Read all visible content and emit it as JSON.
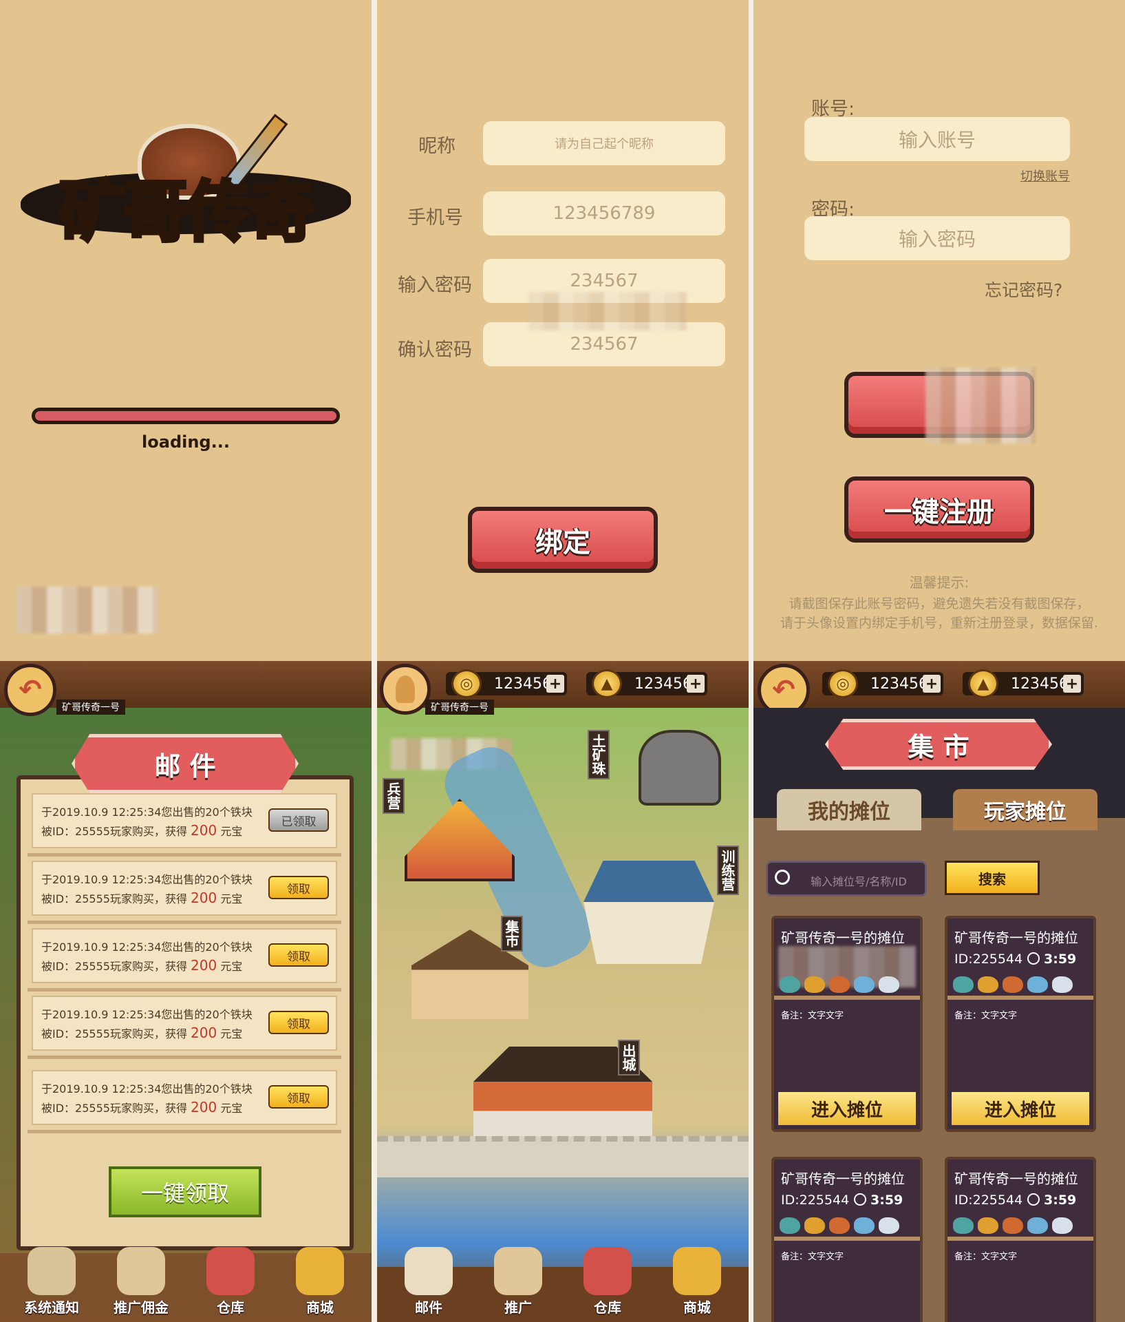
{
  "loading": {
    "logo_text": "矿哥传奇",
    "loading_label": "loading..."
  },
  "bind": {
    "nickname_label": "昵称",
    "nickname_placeholder": "请为自己起个昵称",
    "phone_label": "手机号",
    "phone_value": "123456789",
    "password_label": "输入密码",
    "password_value": "234567",
    "confirm_label": "确认密码",
    "confirm_value": "234567",
    "bind_button": "绑定"
  },
  "login": {
    "account_label": "账号:",
    "account_placeholder": "输入账号",
    "switch_account": "切换账号",
    "password_label": "密码:",
    "password_placeholder": "输入密码",
    "forgot": "忘记密码?",
    "register_button": "一键注册",
    "tip_title": "温馨提示:",
    "tip_line1": "请截图保存此账号密码，避免遗失若没有截图保存，",
    "tip_line2": "请于头像设置内绑定手机号，重新注册登录，数据保留."
  },
  "mail": {
    "title": "邮 件",
    "player_name": "矿哥传奇一号",
    "items": [
      {
        "line1": "于2019.10.9  12:25:34您出售的20个铁块",
        "line2": "被ID：25555玩家购买，获得",
        "amount": "200",
        "unit": "元宝",
        "button": "已领取",
        "claimed": true
      },
      {
        "line1": "于2019.10.9  12:25:34您出售的20个铁块",
        "line2": "被ID：25555玩家购买，获得",
        "amount": "200",
        "unit": "元宝",
        "button": "领取",
        "claimed": false
      },
      {
        "line1": "于2019.10.9  12:25:34您出售的20个铁块",
        "line2": "被ID：25555玩家购买，获得",
        "amount": "200",
        "unit": "元宝",
        "button": "领取",
        "claimed": false
      },
      {
        "line1": "于2019.10.9  12:25:34您出售的20个铁块",
        "line2": "被ID：25555玩家购买，获得",
        "amount": "200",
        "unit": "元宝",
        "button": "领取",
        "claimed": false
      },
      {
        "line1": "于2019.10.9  12:25:34您出售的20个铁块",
        "line2": "被ID：25555玩家购买，获得",
        "amount": "200",
        "unit": "元宝",
        "button": "领取",
        "claimed": false
      }
    ],
    "claim_all": "一键领取",
    "nav": [
      "系统通知",
      "推广佣金",
      "仓库",
      "商城"
    ]
  },
  "map": {
    "player_name": "矿哥传奇一号",
    "coins": "123456",
    "ingots": "123456",
    "signs": [
      "土矿珠",
      "兵营",
      "训练营",
      "集市",
      "出城"
    ],
    "nav": [
      "邮件",
      "推广",
      "仓库",
      "商城"
    ]
  },
  "market": {
    "coins": "123456",
    "ingots": "123456",
    "title": "集 市",
    "tab_mine": "我的摊位",
    "tab_players": "玩家摊位",
    "search_placeholder": "输入摊位号/名称/ID",
    "search_button": "搜索",
    "stalls": [
      {
        "name": "矿哥传奇一号的摊位",
        "id": "ID:225544",
        "time": "3:59",
        "note": "备注：文字文字",
        "enter": "进入摊位"
      },
      {
        "name": "矿哥传奇一号的摊位",
        "id": "ID:225544",
        "time": "3:59",
        "note": "备注：文字文字",
        "enter": "进入摊位"
      },
      {
        "name": "矿哥传奇一号的摊位",
        "id": "ID:225544",
        "time": "3:59",
        "note": "备注：文字文字",
        "enter": "进入摊位"
      },
      {
        "name": "矿哥传奇一号的摊位",
        "id": "ID:225544",
        "time": "3:59",
        "note": "备注：文字文字",
        "enter": "进入摊位"
      }
    ]
  },
  "colors": {
    "tan_bg": "#e3c48e",
    "red_button": "#e15d5e",
    "gold": "#f0bc35"
  }
}
